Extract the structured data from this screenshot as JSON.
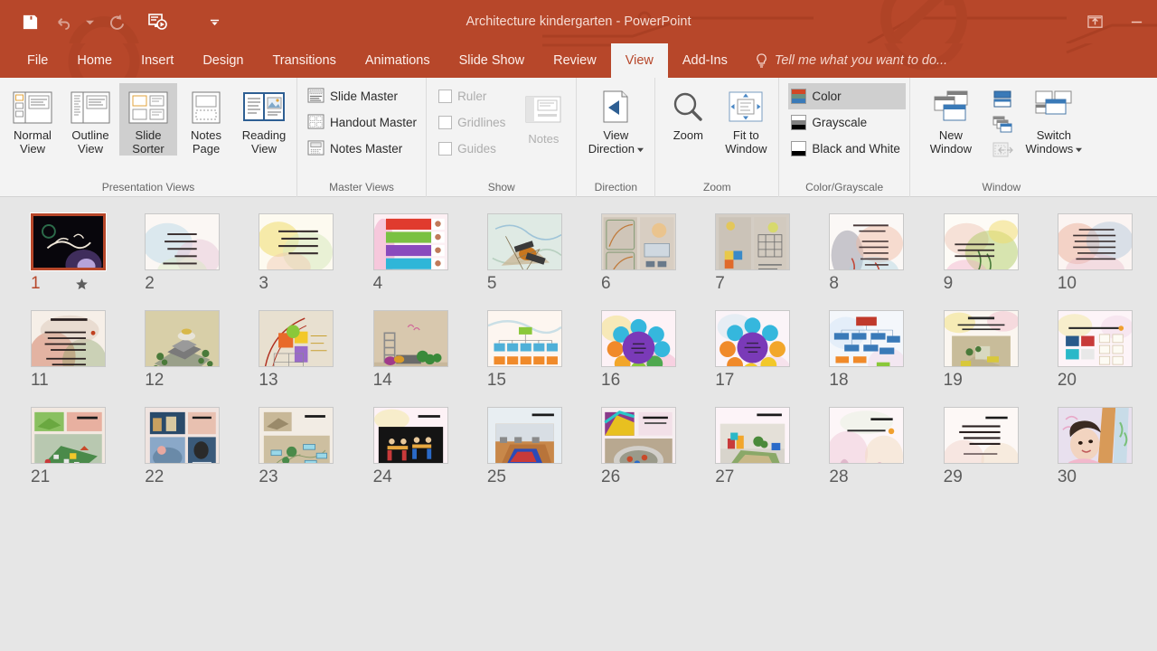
{
  "window": {
    "title": "Architecture kindergarten - PowerPoint",
    "accent_color": "#b7472a",
    "ribbon_bg": "#f3f3f3",
    "workspace_bg": "#e6e6e6"
  },
  "quick_access": [
    {
      "name": "save",
      "icon": "save-icon",
      "enabled": true
    },
    {
      "name": "undo",
      "icon": "undo-icon",
      "enabled": false
    },
    {
      "name": "undo-dropdown",
      "icon": "chevron-down-icon",
      "enabled": false
    },
    {
      "name": "redo",
      "icon": "redo-icon",
      "enabled": false
    },
    {
      "name": "start-from-beginning",
      "icon": "slideshow-icon",
      "enabled": true
    },
    {
      "name": "customize-qat",
      "icon": "chevron-down-icon",
      "enabled": true
    }
  ],
  "title_bar_buttons": [
    {
      "name": "ribbon-display-options",
      "icon": "ribbon-display-icon"
    },
    {
      "name": "minimize",
      "icon": "minimize-icon"
    }
  ],
  "tabs": [
    {
      "label": "File",
      "active": false
    },
    {
      "label": "Home",
      "active": false
    },
    {
      "label": "Insert",
      "active": false
    },
    {
      "label": "Design",
      "active": false
    },
    {
      "label": "Transitions",
      "active": false
    },
    {
      "label": "Animations",
      "active": false
    },
    {
      "label": "Slide Show",
      "active": false
    },
    {
      "label": "Review",
      "active": false
    },
    {
      "label": "View",
      "active": true
    },
    {
      "label": "Add-Ins",
      "active": false
    }
  ],
  "tell_me": {
    "placeholder": "Tell me what you want to do...",
    "icon": "lightbulb-icon"
  },
  "ribbon": {
    "groups": [
      {
        "title": "Presentation Views",
        "buttons": [
          {
            "label_top": "Normal",
            "label_bottom": "View",
            "icon": "normal-view-icon",
            "selected": false
          },
          {
            "label_top": "Outline",
            "label_bottom": "View",
            "icon": "outline-view-icon",
            "selected": false
          },
          {
            "label_top": "Slide",
            "label_bottom": "Sorter",
            "icon": "slide-sorter-icon",
            "selected": true
          },
          {
            "label_top": "Notes",
            "label_bottom": "Page",
            "icon": "notes-page-icon",
            "selected": false
          },
          {
            "label_top": "Reading",
            "label_bottom": "View",
            "icon": "reading-view-icon",
            "selected": false
          }
        ]
      },
      {
        "title": "Master Views",
        "items": [
          {
            "label": "Slide Master",
            "icon": "slide-master-icon"
          },
          {
            "label": "Handout Master",
            "icon": "handout-master-icon"
          },
          {
            "label": "Notes Master",
            "icon": "notes-master-icon"
          }
        ]
      },
      {
        "title": "Show",
        "has_dialog_launcher": true,
        "checkboxes": [
          {
            "label": "Ruler",
            "checked": false,
            "enabled": false
          },
          {
            "label": "Gridlines",
            "checked": false,
            "enabled": false
          },
          {
            "label": "Guides",
            "checked": false,
            "enabled": false
          }
        ],
        "notes_button": {
          "label": "Notes",
          "icon": "notes-icon",
          "enabled": false
        }
      },
      {
        "title": "Direction",
        "buttons": [
          {
            "label_top": "View",
            "label_bottom": "Direction",
            "icon": "view-direction-icon",
            "dropdown": true
          }
        ]
      },
      {
        "title": "Zoom",
        "buttons": [
          {
            "label_top": "Zoom",
            "label_bottom": "",
            "icon": "zoom-icon"
          },
          {
            "label_top": "Fit to",
            "label_bottom": "Window",
            "icon": "fit-to-window-icon"
          }
        ]
      },
      {
        "title": "Color/Grayscale",
        "items": [
          {
            "label": "Color",
            "icon": "color-swatch-icon",
            "selected": true,
            "swatch": [
              "#d24726",
              "#6b9080",
              "#3a7ab8"
            ]
          },
          {
            "label": "Grayscale",
            "icon": "grayscale-swatch-icon",
            "selected": false,
            "swatch": [
              "#ffffff",
              "#808080",
              "#000000"
            ]
          },
          {
            "label": "Black and White",
            "icon": "blackwhite-swatch-icon",
            "selected": false,
            "swatch": [
              "#ffffff",
              "#ffffff",
              "#000000"
            ]
          }
        ]
      },
      {
        "title": "Window",
        "buttons": [
          {
            "label_top": "New",
            "label_bottom": "Window",
            "icon": "new-window-icon"
          },
          {
            "label_top": "Switch",
            "label_bottom": "Windows",
            "icon": "switch-windows-icon",
            "dropdown": true
          }
        ],
        "small_icons": [
          {
            "name": "arrange-all-icon",
            "enabled": true
          },
          {
            "name": "cascade-icon",
            "enabled": true
          },
          {
            "name": "move-split-icon",
            "enabled": false
          }
        ]
      }
    ]
  },
  "slide_sorter": {
    "selected_slide": 1,
    "rows": [
      [
        {
          "number": "1",
          "has_animation": true,
          "selected": true,
          "style": "dark-calligraphy"
        },
        {
          "number": "2",
          "has_animation": false,
          "selected": false,
          "style": "text-watercolor"
        },
        {
          "number": "3",
          "has_animation": false,
          "selected": false,
          "style": "text-watercolor-yellow"
        },
        {
          "number": "4",
          "has_animation": false,
          "selected": false,
          "style": "color-bars"
        },
        {
          "number": "5",
          "has_animation": false,
          "selected": false,
          "style": "photo-sketch"
        },
        {
          "number": "6",
          "has_animation": false,
          "selected": false,
          "style": "scan-pages"
        },
        {
          "number": "7",
          "has_animation": false,
          "selected": false,
          "style": "plan-drawing"
        },
        {
          "number": "8",
          "has_animation": false,
          "selected": false,
          "style": "text-watercolor-blue"
        },
        {
          "number": "9",
          "has_animation": false,
          "selected": false,
          "style": "text-watercolor-green"
        },
        {
          "number": "10",
          "has_animation": false,
          "selected": false,
          "style": "text-watercolor-pink"
        }
      ],
      [
        {
          "number": "11",
          "has_animation": false,
          "selected": false,
          "style": "text-watercolor-red"
        },
        {
          "number": "12",
          "has_animation": false,
          "selected": false,
          "style": "render-3d-tan"
        },
        {
          "number": "13",
          "has_animation": false,
          "selected": false,
          "style": "site-diagram"
        },
        {
          "number": "14",
          "has_animation": false,
          "selected": false,
          "style": "render-playground"
        },
        {
          "number": "15",
          "has_animation": false,
          "selected": false,
          "style": "org-chart"
        },
        {
          "number": "16",
          "has_animation": false,
          "selected": false,
          "style": "radial-diagram"
        },
        {
          "number": "17",
          "has_animation": false,
          "selected": false,
          "style": "radial-diagram-2"
        },
        {
          "number": "18",
          "has_animation": false,
          "selected": false,
          "style": "tree-chart"
        },
        {
          "number": "19",
          "has_animation": false,
          "selected": false,
          "style": "render-model"
        },
        {
          "number": "20",
          "has_animation": false,
          "selected": false,
          "style": "gallery-grid"
        }
      ],
      [
        {
          "number": "21",
          "has_animation": false,
          "selected": false,
          "style": "render-green-site"
        },
        {
          "number": "22",
          "has_animation": false,
          "selected": false,
          "style": "photo-collage"
        },
        {
          "number": "23",
          "has_animation": false,
          "selected": false,
          "style": "plan-labeled"
        },
        {
          "number": "24",
          "has_animation": false,
          "selected": false,
          "style": "render-classroom"
        },
        {
          "number": "25",
          "has_animation": false,
          "selected": false,
          "style": "render-hall"
        },
        {
          "number": "26",
          "has_animation": false,
          "selected": false,
          "style": "photo-pair"
        },
        {
          "number": "27",
          "has_animation": false,
          "selected": false,
          "style": "render-playroom"
        },
        {
          "number": "28",
          "has_animation": false,
          "selected": false,
          "style": "text-light-pink"
        },
        {
          "number": "29",
          "has_animation": false,
          "selected": false,
          "style": "text-quote"
        },
        {
          "number": "30",
          "has_animation": false,
          "selected": false,
          "style": "photo-child"
        }
      ]
    ]
  }
}
